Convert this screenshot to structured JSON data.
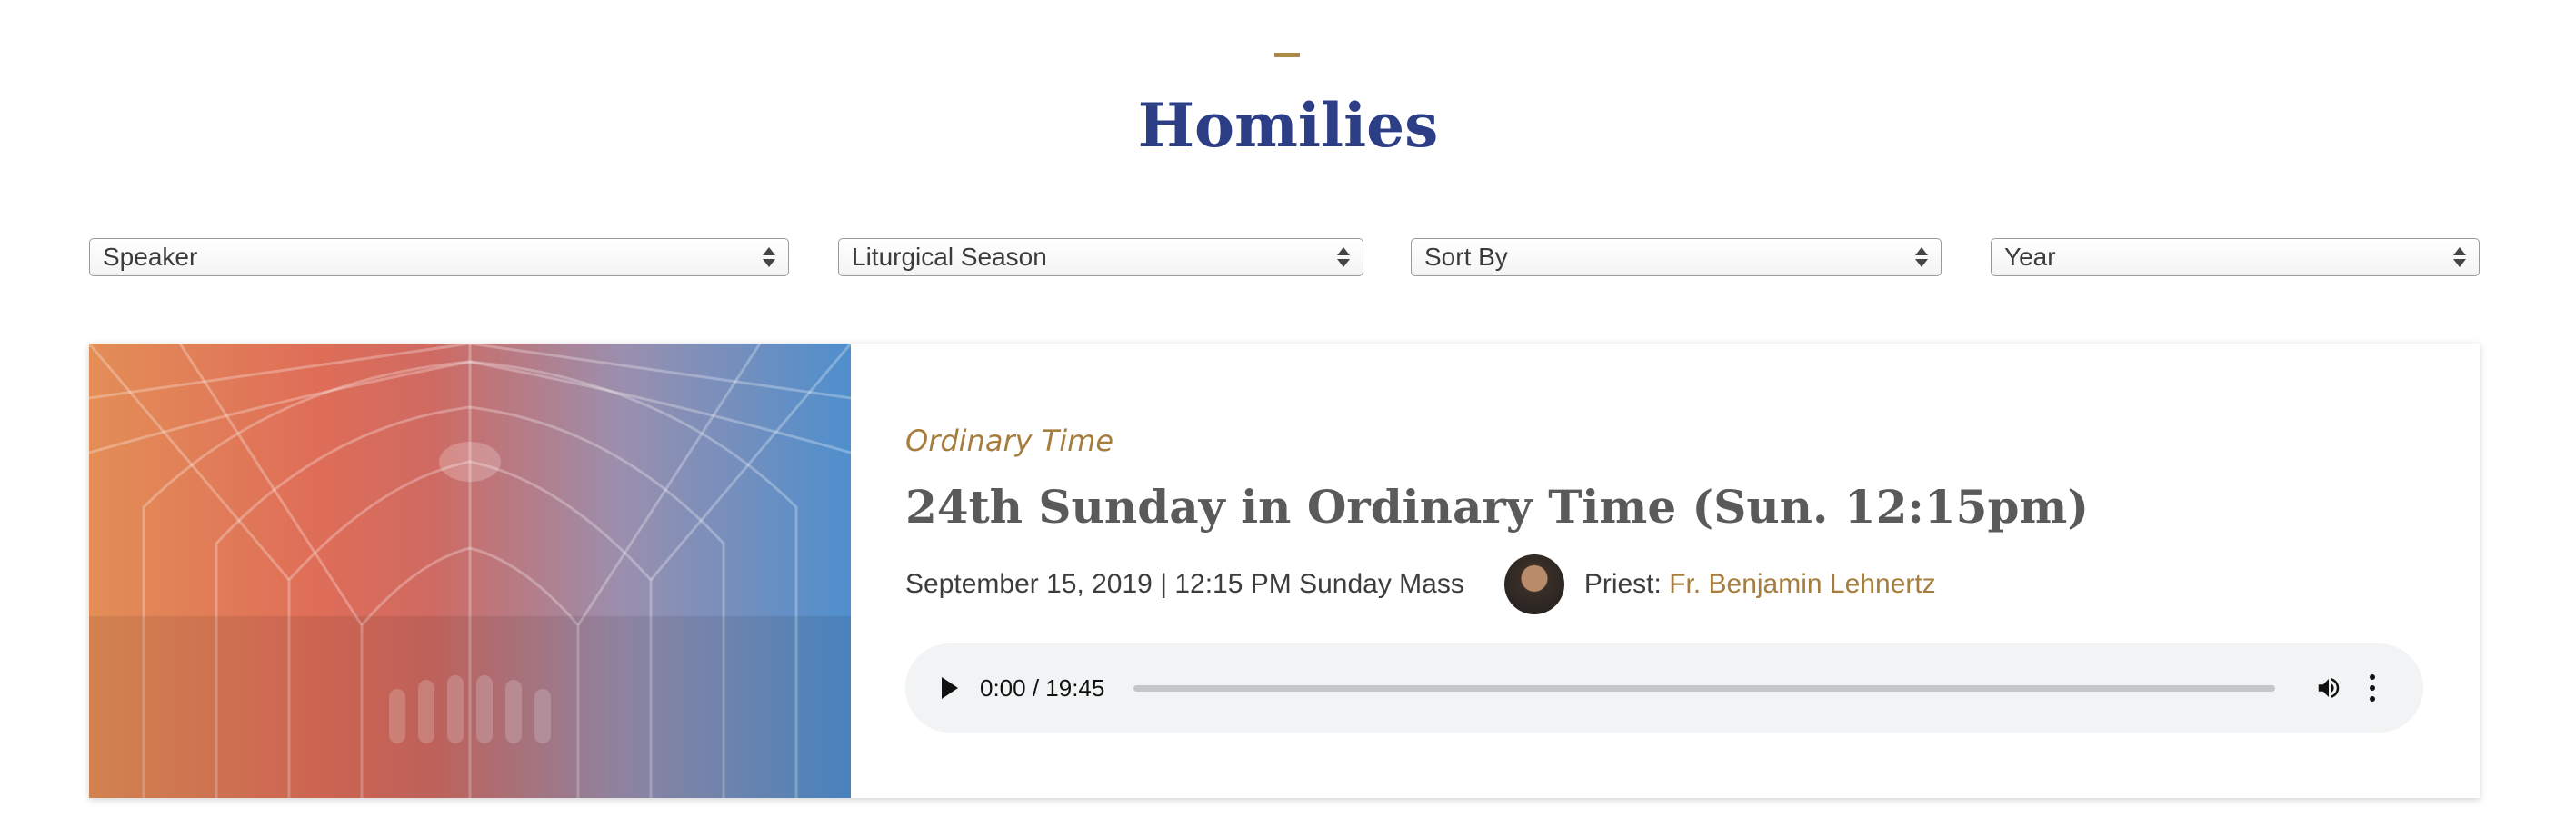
{
  "page": {
    "title": "Homilies"
  },
  "filters": [
    {
      "label": "Speaker"
    },
    {
      "label": "Liturgical Season"
    },
    {
      "label": "Sort By"
    },
    {
      "label": "Year"
    }
  ],
  "homily": {
    "season": "Ordinary Time",
    "title": "24th Sunday in Ordinary Time (Sun. 12:15pm)",
    "date_line": "September 15, 2019 | 12:15 PM Sunday Mass",
    "priest_prefix": "Priest: ",
    "priest_name": "Fr. Benjamin Lehnertz",
    "audio": {
      "time": "0:00 / 19:45",
      "progress": 0
    }
  },
  "colors": {
    "title": "#2c3e86",
    "accent": "#a67d3d"
  },
  "icons": [
    "play-icon",
    "volume-icon",
    "more-options-icon",
    "dropdown-arrows-icon"
  ]
}
